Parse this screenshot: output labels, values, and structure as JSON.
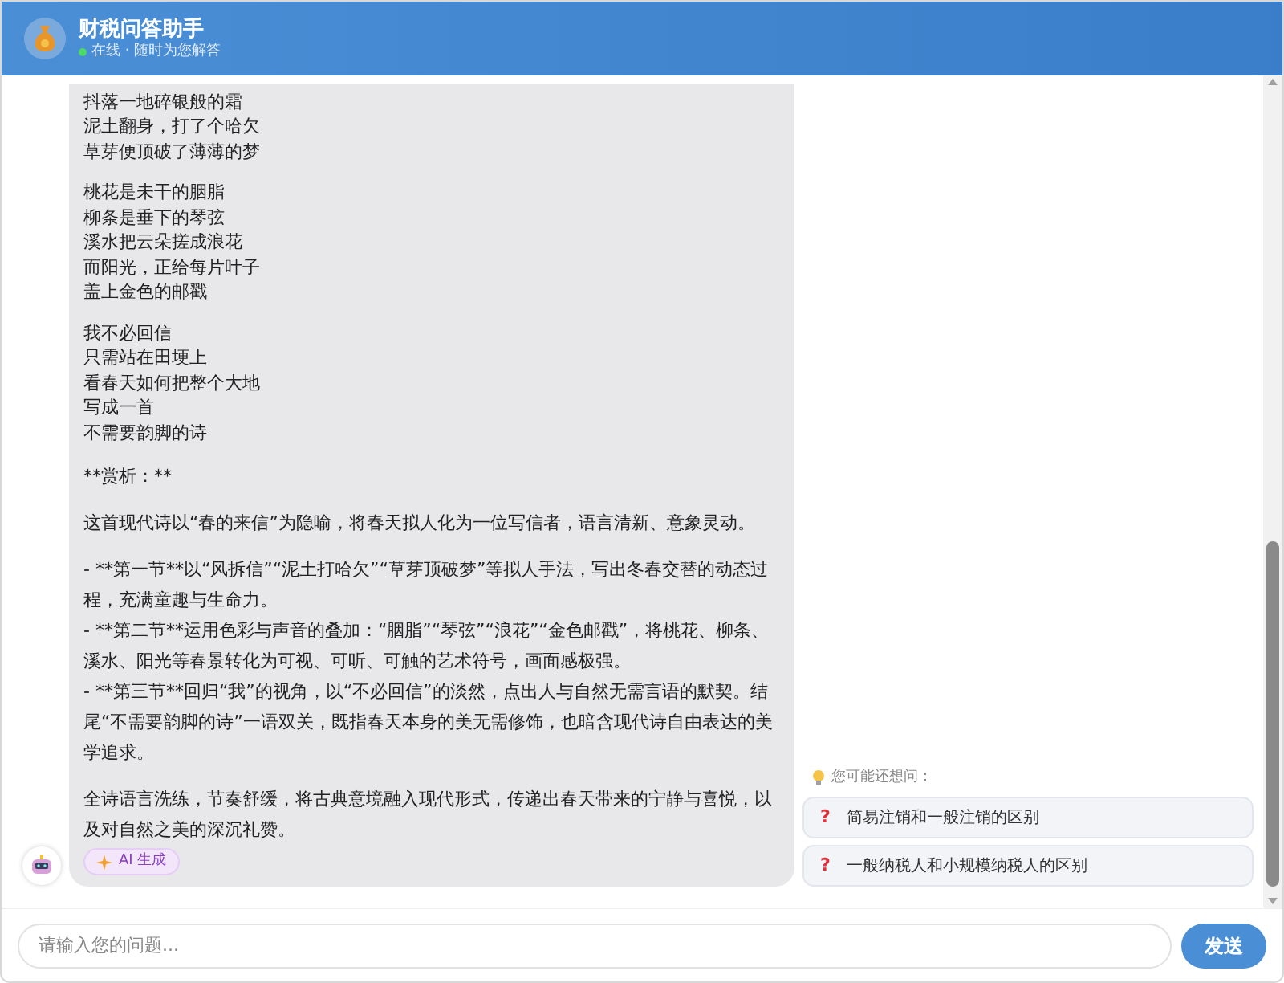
{
  "header": {
    "title": "财税问答助手",
    "status": "在线 · 随时为您解答",
    "online": true
  },
  "message": {
    "blocks": [
      {
        "kind": "poem",
        "lines": [
          "抖落一地碎银般的霜",
          "泥土翻身，打了个哈欠",
          "草芽便顶破了薄薄的梦"
        ]
      },
      {
        "kind": "poem",
        "lines": [
          "桃花是未干的胭脂",
          "柳条是垂下的琴弦",
          "溪水把云朵搓成浪花",
          "而阳光，正给每片叶子",
          "盖上金色的邮戳"
        ]
      },
      {
        "kind": "poem",
        "lines": [
          "我不必回信",
          "只需站在田埂上",
          "看春天如何把整个大地",
          "写成一首",
          "不需要韵脚的诗"
        ]
      },
      {
        "kind": "text",
        "text": "**赏析：**"
      },
      {
        "kind": "text",
        "text": "这首现代诗以“春的来信”为隐喻，将春天拟人化为一位写信者，语言清新、意象灵动。"
      },
      {
        "kind": "list",
        "lines": [
          "- **第一节**以“风拆信”“泥土打哈欠”“草芽顶破梦”等拟人手法，写出冬春交替的动态过程，充满童趣与生命力。",
          "- **第二节**运用色彩与声音的叠加：“胭脂”“琴弦”“浪花”“金色邮戳”，将桃花、柳条、溪水、阳光等春景转化为可视、可听、可触的艺术符号，画面感极强。",
          "- **第三节**回归“我”的视角，以“不必回信”的淡然，点出人与自然无需言语的默契。结尾“不需要韵脚的诗”一语双关，既指春天本身的美无需修饰，也暗含现代诗自由表达的美学追求。"
        ]
      },
      {
        "kind": "text",
        "text": "全诗语言洗练，节奏舒缓，将古典意境融入现代形式，传递出春天带来的宁静与喜悦，以及对自然之美的深沉礼赞。"
      }
    ],
    "badge": "AI 生成"
  },
  "suggestions": {
    "label": "您可能还想问：",
    "items": [
      {
        "marker": "?",
        "text": "简易注销和一般注销的区别"
      },
      {
        "marker": "?",
        "text": "一般纳税人和小规模纳税人的区别"
      }
    ]
  },
  "input": {
    "placeholder": "请输入您的问题...",
    "send": "发送"
  }
}
